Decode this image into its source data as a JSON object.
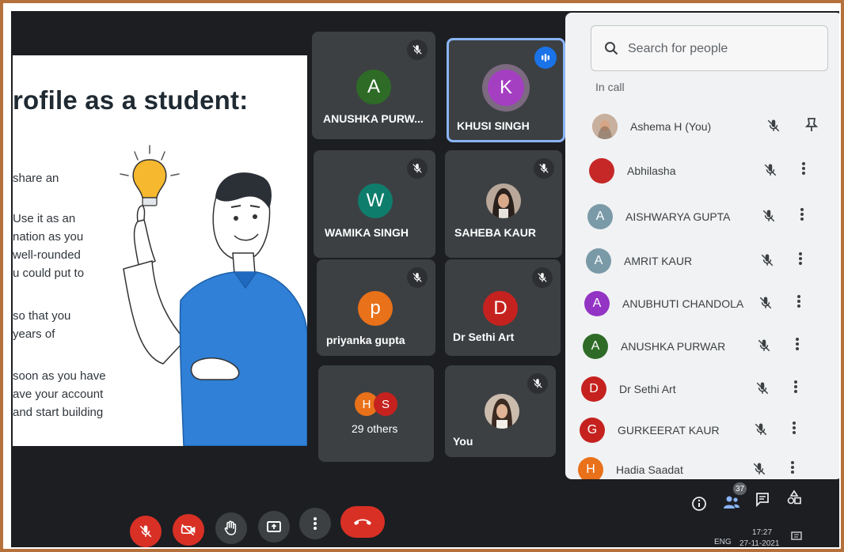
{
  "slide": {
    "title": "rofile as a student:",
    "lines": [
      "share an",
      "Use it as an",
      "nation as you",
      "well-rounded",
      "u could put to",
      "so that you",
      "years of",
      "soon as you have",
      "ave your account",
      "and start building"
    ]
  },
  "tiles": [
    {
      "name": "ANUSHKA PURW...",
      "initial": "A",
      "color": "#2e6b27"
    },
    {
      "name": "KHUSI SINGH",
      "initial": "K",
      "color": "#a43fc2"
    },
    {
      "name": "WAMIKA SINGH",
      "initial": "W",
      "color": "#0f7d6c"
    },
    {
      "name": "SAHEBA KAUR"
    },
    {
      "name": "priyanka gupta",
      "initial": "p",
      "color": "#e8711a"
    },
    {
      "name": "Dr Sethi Art",
      "initial": "D",
      "color": "#c5221f"
    },
    {
      "name": "29 others",
      "initials": [
        "H",
        "S"
      ]
    },
    {
      "name": "You"
    }
  ],
  "panel": {
    "search_placeholder": "Search for people",
    "section_label": "In call",
    "people": [
      {
        "name": "Ashema H (You)",
        "color": "#8a6a5a",
        "icon": "pin-icon"
      },
      {
        "name": "Abhilasha",
        "color": "#c62828",
        "icon": "more-icon"
      },
      {
        "name": "AISHWARYA GUPTA",
        "initial": "A",
        "color": "#7a9aa8",
        "icon": "more-icon"
      },
      {
        "name": "AMRIT KAUR",
        "initial": "A",
        "color": "#7a9aa8",
        "icon": "more-icon"
      },
      {
        "name": "ANUBHUTI CHANDOLA",
        "initial": "A",
        "color": "#9334c4",
        "icon": "more-icon"
      },
      {
        "name": "ANUSHKA PURWAR",
        "initial": "A",
        "color": "#2e6b27",
        "icon": "more-icon"
      },
      {
        "name": "Dr Sethi Art",
        "initial": "D",
        "color": "#c5221f",
        "icon": "more-icon"
      },
      {
        "name": "GURKEERAT KAUR",
        "initial": "G",
        "color": "#c5221f",
        "icon": "more-icon"
      },
      {
        "name": "Hadia Saadat",
        "initial": "H",
        "color": "#e8711a",
        "icon": "more-icon"
      }
    ]
  },
  "controls": {
    "people_count": "37",
    "language": "ENG",
    "time": "17:27",
    "date": "27-11-2021"
  }
}
